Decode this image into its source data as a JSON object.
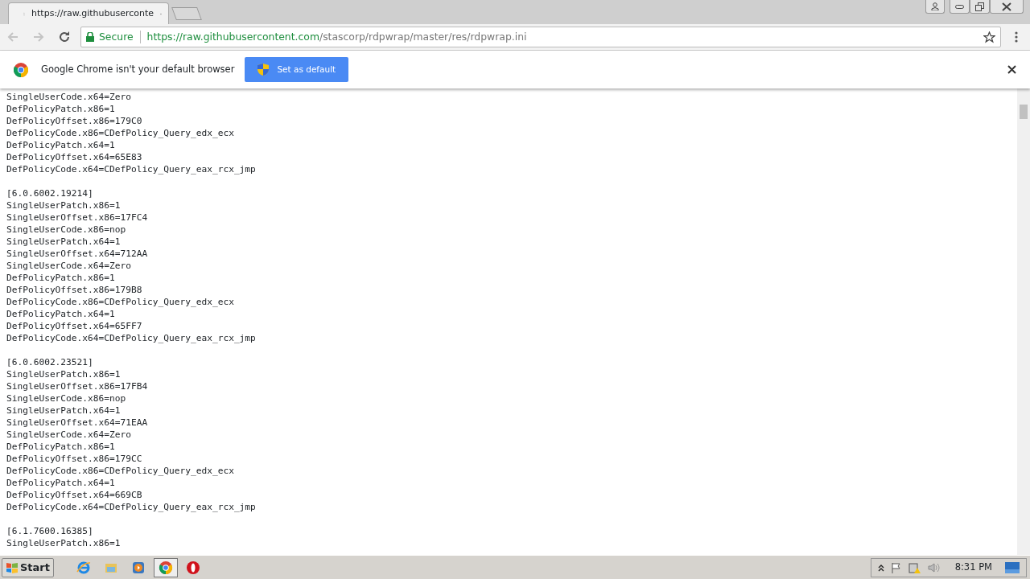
{
  "tabs": [
    {
      "title": "https://raw.githubuserconte",
      "selected": true
    }
  ],
  "address_bar": {
    "security": "Secure",
    "url_host": "https://raw.githubusercontent.com",
    "url_path": "/stascorp/rdpwrap/master/res/rdpwrap.ini"
  },
  "infobar": {
    "message": "Google Chrome isn't your default browser",
    "button": "Set as default"
  },
  "sections": [
    {
      "lines": [
        "SingleUserCode.x64=Zero",
        "DefPolicyPatch.x86=1",
        "DefPolicyOffset.x86=179C0",
        "DefPolicyCode.x86=CDefPolicy_Query_edx_ecx",
        "DefPolicyPatch.x64=1",
        "DefPolicyOffset.x64=65E83",
        "DefPolicyCode.x64=CDefPolicy_Query_eax_rcx_jmp"
      ]
    },
    {
      "header": "[6.0.6002.19214]",
      "lines": [
        "SingleUserPatch.x86=1",
        "SingleUserOffset.x86=17FC4",
        "SingleUserCode.x86=nop",
        "SingleUserPatch.x64=1",
        "SingleUserOffset.x64=712AA",
        "SingleUserCode.x64=Zero",
        "DefPolicyPatch.x86=1",
        "DefPolicyOffset.x86=179B8",
        "DefPolicyCode.x86=CDefPolicy_Query_edx_ecx",
        "DefPolicyPatch.x64=1",
        "DefPolicyOffset.x64=65FF7",
        "DefPolicyCode.x64=CDefPolicy_Query_eax_rcx_jmp"
      ]
    },
    {
      "header": "[6.0.6002.23521]",
      "lines": [
        "SingleUserPatch.x86=1",
        "SingleUserOffset.x86=17FB4",
        "SingleUserCode.x86=nop",
        "SingleUserPatch.x64=1",
        "SingleUserOffset.x64=71EAA",
        "SingleUserCode.x64=Zero",
        "DefPolicyPatch.x86=1",
        "DefPolicyOffset.x86=179CC",
        "DefPolicyCode.x86=CDefPolicy_Query_edx_ecx",
        "DefPolicyPatch.x64=1",
        "DefPolicyOffset.x64=669CB",
        "DefPolicyCode.x64=CDefPolicy_Query_eax_rcx_jmp"
      ]
    },
    {
      "header": "[6.1.7600.16385]",
      "lines": [
        "SingleUserPatch.x86=1"
      ]
    }
  ],
  "taskbar": {
    "start": "Start",
    "apps": [
      {
        "kind": "ie",
        "selected": false
      },
      {
        "kind": "explorer",
        "selected": false
      },
      {
        "kind": "media",
        "selected": false
      },
      {
        "kind": "chrome",
        "selected": true
      },
      {
        "kind": "opera",
        "selected": false
      }
    ],
    "clock": "8:31 PM"
  }
}
